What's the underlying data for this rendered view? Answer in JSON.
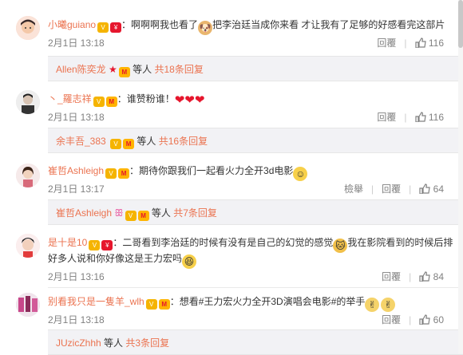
{
  "colors": {
    "username": "#eb7350",
    "meta": "#808080",
    "sub_bg": "#f2f2f5"
  },
  "comments": [
    {
      "username": "小曦guiano",
      "text_a": "：啊啊啊我也看了",
      "text_b": "把李治廷当成你来看 才让我有了足够的好感看完这部片",
      "time": "2月1日 13:18",
      "reply": "回覆",
      "likes": "116",
      "sub": {
        "who": "Allen陈奕龙",
        "rest": "等人",
        "count": "共18条回复"
      }
    },
    {
      "username": "丶_羅志祥",
      "text": "：谁赞粉谁！",
      "time": "2月1日 13:18",
      "reply": "回覆",
      "likes": "116",
      "sub": {
        "who": "余丰吾_383",
        "rest": "等人",
        "count": "共16条回复"
      }
    },
    {
      "username": "崔哲Ashleigh",
      "text": "：期待你跟我们一起看火力全开3d电影",
      "time": "2月1日 13:17",
      "report": "檢舉",
      "reply": "回覆",
      "likes": "64",
      "sub": {
        "who": "崔哲Ashleigh",
        "rest": "等人",
        "count": "共7条回复"
      }
    },
    {
      "username": "是十是10",
      "text_a": "：二哥看到李治廷的时候有没有是自己的幻觉的感觉",
      "text_b": "我在影院看到的时候后排",
      "text_c": "好多人说和你好像这是王力宏吗",
      "time": "2月1日 13:16",
      "reply": "回覆",
      "likes": "84"
    },
    {
      "username": "别看我只是一隻羊_wlh",
      "text": "：想看#王力宏火力全开3D演唱会电影#的举手",
      "time": "2月1日 13:18",
      "reply": "回覆",
      "likes": "60",
      "sub": {
        "who": "JUzicZhhh",
        "rest": "等人",
        "count": "共3条回复"
      }
    }
  ]
}
